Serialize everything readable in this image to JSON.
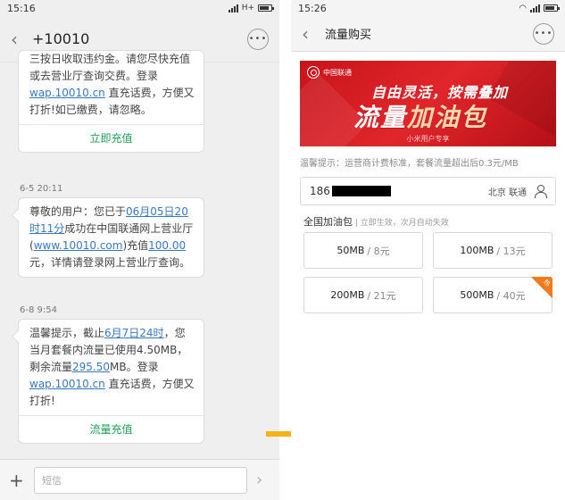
{
  "left": {
    "status_time": "15:16",
    "status_network": "H+",
    "title": "+10010",
    "messages": [
      {
        "text_parts": [
          "三按日收取违约金。请您尽快充值或去营业厅查询交费。登录"
        ],
        "link": "wap.10010.cn",
        "text_after": "直充话费，方便又打折!如已缴费，请忽略。",
        "action": "立即充值"
      },
      {
        "timestamp": "6-5 20:11",
        "p1": "尊敬的用户：您已于",
        "l1": "06月05日20时11分",
        "p2": "成功在中国联通网上营业厅(",
        "l2": "www.10010.com",
        "p3": ")充值",
        "l3": "100.00",
        "p4": "元，详情请登录网上营业厅查询。"
      },
      {
        "timestamp": "6-8 9:54",
        "p1": "温馨提示，截止",
        "l1": "6月7日24时",
        "p2": "，您当月套餐内流量已使用4.50MB，剩余流量",
        "l2": "295.50",
        "p3": "MB。登录",
        "l3": "wap.10010.cn",
        "p4": "直充话费，方便又打折!",
        "action": "流量充值"
      }
    ],
    "composer_placeholder": "短信"
  },
  "right": {
    "status_time": "15:26",
    "title": "流量购买",
    "banner": {
      "brand": "中国联通",
      "headline": "自由灵活，按需叠加",
      "big_a": "流量",
      "big_b": "加油包",
      "tag": "小米用户专享"
    },
    "tip": "温馨提示：运营商计费标准，套餐流量超出后0.3元/MB",
    "phone_prefix": "186",
    "carrier": "北京 联通",
    "section_title": "全国加油包",
    "section_sub": " | 立即生效，次月自动失效",
    "packages": [
      {
        "size": "50MB",
        "price": "/ 8元"
      },
      {
        "size": "100MB",
        "price": "/ 13元"
      },
      {
        "size": "200MB",
        "price": "/ 21元"
      },
      {
        "size": "500MB",
        "price": "/ 40元",
        "badge": "热"
      }
    ],
    "colors": {
      "brand_red": "#d7191f",
      "link_blue": "#3a78c4",
      "action_green": "#1e9e5a",
      "badge_orange": "#f27b1e",
      "arrow": "#f5b21a"
    }
  }
}
